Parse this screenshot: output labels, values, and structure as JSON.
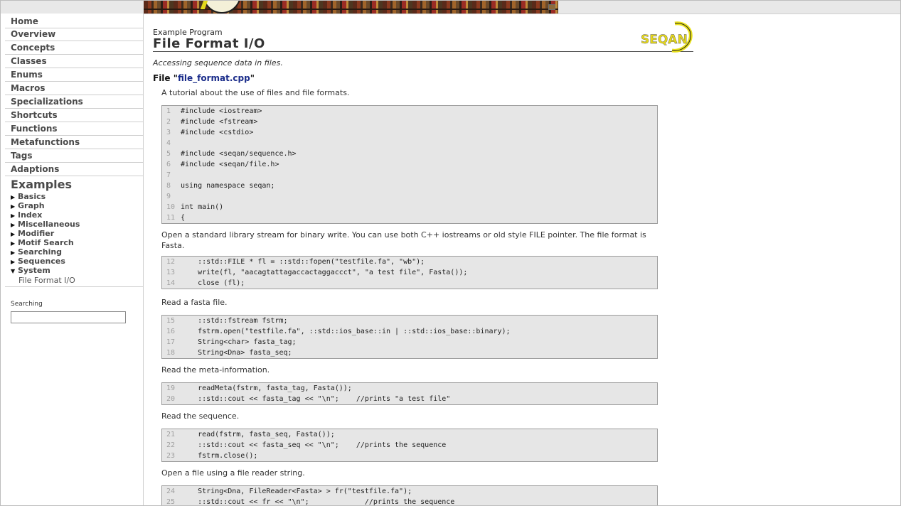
{
  "sidebar": {
    "nav": [
      "Home",
      "Overview",
      "Concepts",
      "Classes",
      "Enums",
      "Macros",
      "Specializations",
      "Shortcuts",
      "Functions",
      "Metafunctions",
      "Tags",
      "Adaptions"
    ],
    "examples_heading": "Examples",
    "examples": [
      {
        "label": "Basics",
        "expanded": false
      },
      {
        "label": "Graph",
        "expanded": false
      },
      {
        "label": "Index",
        "expanded": false
      },
      {
        "label": "Miscellaneous",
        "expanded": false
      },
      {
        "label": "Modifier",
        "expanded": false
      },
      {
        "label": "Motif Search",
        "expanded": false
      },
      {
        "label": "Searching",
        "expanded": false
      },
      {
        "label": "Sequences",
        "expanded": false
      },
      {
        "label": "System",
        "expanded": true
      }
    ],
    "expanded_child": "File Format I/O",
    "search_label": "Searching",
    "search_value": ""
  },
  "main": {
    "prog_label": "Example Program",
    "title": "File Format I/O",
    "logo_text": "SEQAN",
    "subtitle": "Accessing sequence data in files.",
    "file_prefix": "File \"",
    "file_name": "file_format.cpp",
    "file_suffix": "\"",
    "sections": [
      {
        "text": "A tutorial about the use of files and file formats.",
        "code": [
          {
            "n": "1",
            "t": "#include <iostream>"
          },
          {
            "n": "2",
            "t": "#include <fstream>"
          },
          {
            "n": "3",
            "t": "#include <cstdio>"
          },
          {
            "n": "4",
            "t": ""
          },
          {
            "n": "5",
            "t": "#include <seqan/sequence.h>"
          },
          {
            "n": "6",
            "t": "#include <seqan/file.h>"
          },
          {
            "n": "7",
            "t": ""
          },
          {
            "n": "8",
            "t": "using namespace seqan;"
          },
          {
            "n": "9",
            "t": ""
          },
          {
            "n": "10",
            "t": "int main()"
          },
          {
            "n": "11",
            "t": "{"
          }
        ]
      },
      {
        "text": "Open a standard library stream for binary write. You can use both C++ iostreams or old style FILE pointer. The file format is Fasta.",
        "code": [
          {
            "n": "12",
            "t": "    ::std::FILE * fl = ::std::fopen(\"testfile.fa\", \"wb\");"
          },
          {
            "n": "13",
            "t": "    write(fl, \"aacagtattagaccactaggaccct\", \"a test file\", Fasta());"
          },
          {
            "n": "14",
            "t": "    close (fl);"
          }
        ]
      },
      {
        "text": "Read a fasta file.",
        "code": [
          {
            "n": "15",
            "t": "    ::std::fstream fstrm;"
          },
          {
            "n": "16",
            "t": "    fstrm.open(\"testfile.fa\", ::std::ios_base::in | ::std::ios_base::binary);"
          },
          {
            "n": "17",
            "t": "    String<char> fasta_tag;"
          },
          {
            "n": "18",
            "t": "    String<Dna> fasta_seq;"
          }
        ]
      },
      {
        "text": "Read the meta-information.",
        "code": [
          {
            "n": "19",
            "t": "    readMeta(fstrm, fasta_tag, Fasta());"
          },
          {
            "n": "20",
            "t": "    ::std::cout << fasta_tag << \"\\n\";    //prints \"a test file\""
          }
        ]
      },
      {
        "text": "Read the sequence.",
        "code": [
          {
            "n": "21",
            "t": "    read(fstrm, fasta_seq, Fasta());"
          },
          {
            "n": "22",
            "t": "    ::std::cout << fasta_seq << \"\\n\";    //prints the sequence"
          },
          {
            "n": "23",
            "t": "    fstrm.close();"
          }
        ]
      },
      {
        "text": "Open a file using a file reader string.",
        "code": [
          {
            "n": "24",
            "t": "    String<Dna, FileReader<Fasta> > fr(\"testfile.fa\");"
          },
          {
            "n": "25",
            "t": "    ::std::cout << fr << \"\\n\";             //prints the sequence"
          }
        ]
      }
    ]
  }
}
